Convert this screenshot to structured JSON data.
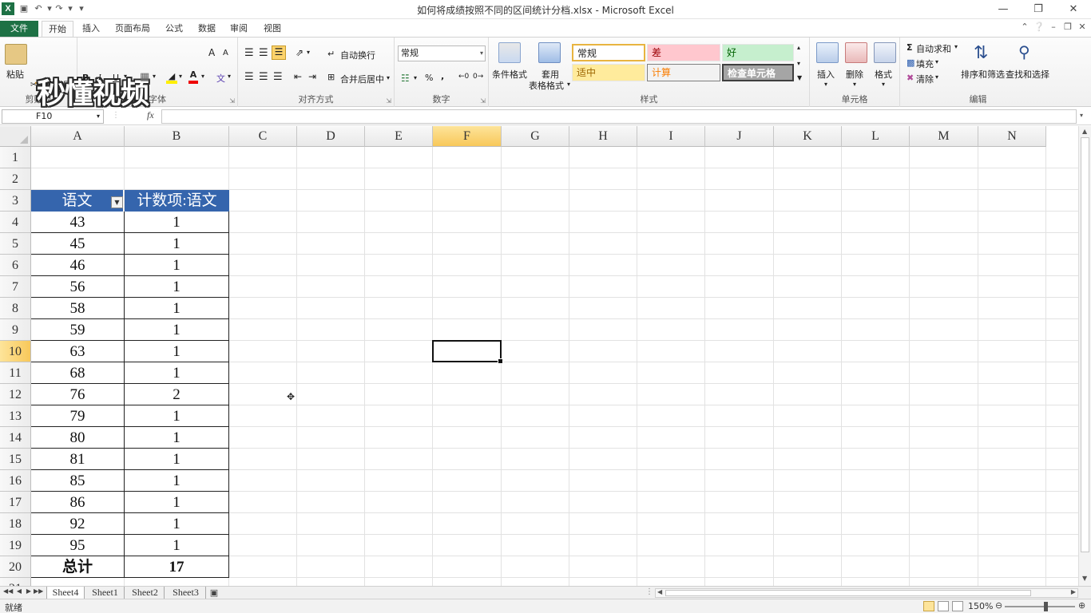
{
  "window": {
    "title": "如何将成绩按照不同的区间统计分档.xlsx - Microsoft Excel",
    "app_icon": "X"
  },
  "tabs": [
    "文件",
    "开始",
    "插入",
    "页面布局",
    "公式",
    "数据",
    "审阅",
    "视图"
  ],
  "watermark": "秒懂视频",
  "ribbon": {
    "clipboard": {
      "paste": "粘贴",
      "format_painter": "格式刷",
      "label": "剪贴板"
    },
    "font": {
      "label": "字体",
      "bold": "B",
      "italic": "I",
      "underline": "U",
      "font_color_letter": "A",
      "phonetic": "文",
      "grow": "A",
      "shrink": "A"
    },
    "alignment": {
      "wrap": "自动换行",
      "merge": "合并后居中",
      "label": "对齐方式"
    },
    "number": {
      "format": "常规",
      "percent": "%",
      "comma": ",",
      "label": "数字"
    },
    "styles": {
      "conditional": "条件格式",
      "table_format_1": "套用",
      "table_format_2": "表格格式",
      "label": "样式",
      "cells": [
        {
          "text": "常规",
          "bg": "#ffffff",
          "fg": "#222222"
        },
        {
          "text": "差",
          "bg": "#ffc7ce",
          "fg": "#9c0006"
        },
        {
          "text": "好",
          "bg": "#c6efce",
          "fg": "#006100"
        },
        {
          "text": "适中",
          "bg": "#ffeb9c",
          "fg": "#9c6500"
        },
        {
          "text": "计算",
          "bg": "#f2f2f2",
          "fg": "#fa7d00"
        },
        {
          "text": "检查单元格",
          "bg": "#a5a5a5",
          "fg": "#ffffff"
        }
      ]
    },
    "cells": {
      "insert": "插入",
      "delete": "删除",
      "format": "格式",
      "label": "单元格"
    },
    "editing": {
      "autosum": "自动求和",
      "fill": "填充",
      "clear": "清除",
      "sort": "排序和筛选",
      "find": "查找和选择",
      "label": "编辑"
    }
  },
  "formula_bar": {
    "name_box": "F10",
    "fx": "fx",
    "value": ""
  },
  "columns": [
    "A",
    "B",
    "C",
    "D",
    "E",
    "F",
    "G",
    "H",
    "I",
    "J",
    "K",
    "L",
    "M",
    "N"
  ],
  "selected_column": "F",
  "rows": [
    "1",
    "2",
    "3",
    "4",
    "5",
    "6",
    "7",
    "8",
    "9",
    "10",
    "11",
    "12",
    "13",
    "14",
    "15",
    "16",
    "17",
    "18",
    "19",
    "20",
    "21"
  ],
  "selected_row": "10",
  "pivot": {
    "header_a": "语文",
    "header_b": "计数项:语文",
    "rows": [
      [
        "43",
        "1"
      ],
      [
        "45",
        "1"
      ],
      [
        "46",
        "1"
      ],
      [
        "56",
        "1"
      ],
      [
        "58",
        "1"
      ],
      [
        "59",
        "1"
      ],
      [
        "63",
        "1"
      ],
      [
        "68",
        "1"
      ],
      [
        "76",
        "2"
      ],
      [
        "79",
        "1"
      ],
      [
        "80",
        "1"
      ],
      [
        "81",
        "1"
      ],
      [
        "85",
        "1"
      ],
      [
        "86",
        "1"
      ],
      [
        "92",
        "1"
      ],
      [
        "95",
        "1"
      ]
    ],
    "total_label": "总计",
    "total_value": "17"
  },
  "sheets": [
    "Sheet4",
    "Sheet1",
    "Sheet2",
    "Sheet3"
  ],
  "active_sheet": "Sheet4",
  "status": {
    "text": "就绪",
    "zoom": "150%"
  },
  "colors": {
    "accent": "#1e7145",
    "pivot_header": "#3565ad",
    "selection": "#f8c85a"
  }
}
